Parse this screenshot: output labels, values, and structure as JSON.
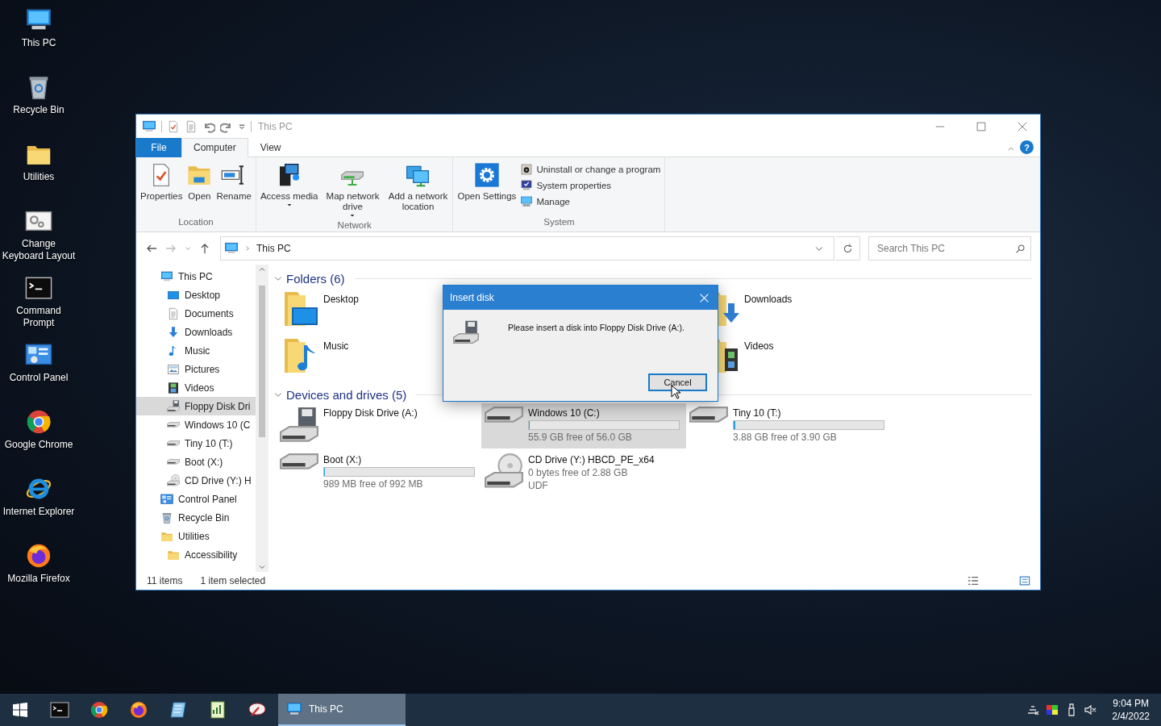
{
  "desktop_icons": [
    {
      "label": "This PC",
      "kind": "pc"
    },
    {
      "label": "Recycle Bin",
      "kind": "bin"
    },
    {
      "label": "Utilities",
      "kind": "folder"
    },
    {
      "label": "Change Keyboard Layout",
      "kind": "settings-window"
    },
    {
      "label": "Command Prompt",
      "kind": "cmd"
    },
    {
      "label": "Control Panel",
      "kind": "cpanel"
    },
    {
      "label": "Google Chrome",
      "kind": "chrome"
    },
    {
      "label": "Internet Explorer",
      "kind": "ie"
    },
    {
      "label": "Mozilla Firefox",
      "kind": "firefox"
    }
  ],
  "window": {
    "title": "This PC"
  },
  "ribbon": {
    "tabs": [
      {
        "label": "File",
        "kind": "file",
        "selected": false
      },
      {
        "label": "Computer",
        "kind": "tab",
        "selected": true
      },
      {
        "label": "View",
        "kind": "tab",
        "selected": false
      }
    ],
    "help": "?",
    "groups": [
      {
        "label": "Location",
        "buttons": [
          {
            "label": "Properties",
            "kind": "properties",
            "dropdown": false
          },
          {
            "label": "Open",
            "kind": "open",
            "dropdown": false
          },
          {
            "label": "Rename",
            "kind": "rename",
            "dropdown": false
          }
        ]
      },
      {
        "label": "Network",
        "buttons": [
          {
            "label": "Access media",
            "kind": "media",
            "dropdown": true
          },
          {
            "label": "Map network drive",
            "kind": "mapdrive",
            "dropdown": true
          },
          {
            "label": "Add a network location",
            "kind": "netloc",
            "dropdown": false
          }
        ]
      },
      {
        "label": "System",
        "buttons": [
          {
            "label": "Open Settings",
            "kind": "gear",
            "dropdown": false
          }
        ],
        "small_buttons": [
          {
            "label": "Uninstall or change a program",
            "kind": "uninstall"
          },
          {
            "label": "System properties",
            "kind": "sysprops"
          },
          {
            "label": "Manage",
            "kind": "manage"
          }
        ]
      }
    ]
  },
  "address_bar": {
    "path": "This PC",
    "search_placeholder": "Search This PC"
  },
  "nav_pane": {
    "items": [
      {
        "label": "This PC",
        "kind": "pc",
        "selected": false,
        "children": [
          {
            "label": "Desktop",
            "kind": "desktop-small",
            "selected": false
          },
          {
            "label": "Documents",
            "kind": "docs",
            "selected": false
          },
          {
            "label": "Downloads",
            "kind": "down",
            "selected": false
          },
          {
            "label": "Music",
            "kind": "music",
            "selected": false
          },
          {
            "label": "Pictures",
            "kind": "pics",
            "selected": false
          },
          {
            "label": "Videos",
            "kind": "videos",
            "selected": false
          },
          {
            "label": "Floppy Disk Dri",
            "kind": "floppy",
            "selected": true
          },
          {
            "label": "Windows 10 (C",
            "kind": "disk",
            "selected": false
          },
          {
            "label": "Tiny 10 (T:)",
            "kind": "disk",
            "selected": false
          },
          {
            "label": "Boot (X:)",
            "kind": "disk",
            "selected": false
          },
          {
            "label": "CD Drive (Y:) H",
            "kind": "cd",
            "selected": false
          }
        ]
      },
      {
        "label": "Control Panel",
        "kind": "cpanel",
        "selected": false
      },
      {
        "label": "Recycle Bin",
        "kind": "bin",
        "selected": false
      },
      {
        "label": "Utilities",
        "kind": "folder",
        "selected": false,
        "children": [
          {
            "label": "Accessibility",
            "kind": "folder",
            "selected": false
          }
        ]
      }
    ]
  },
  "sections": [
    {
      "title": "Folders (6)",
      "expanded": true,
      "kind": "folders",
      "items": [
        {
          "label": "Desktop",
          "kind": "desktopf"
        },
        {
          "label": "Downloads",
          "kind": "downloadsf"
        },
        {
          "label": "Music",
          "kind": "musicf"
        },
        {
          "label": "Videos",
          "kind": "videosf"
        }
      ]
    },
    {
      "title": "Devices and drives (5)",
      "expanded": true,
      "kind": "drives",
      "items": [
        {
          "label": "Floppy Disk Drive (A:)",
          "kind": "floppy",
          "selected": false
        },
        {
          "label": "Windows 10 (C:)",
          "kind": "disk",
          "selected": true,
          "level": 0.002,
          "details": [
            "55.9 GB free of 56.0 GB"
          ]
        },
        {
          "label": "Tiny 10 (T:)",
          "kind": "disk",
          "selected": false,
          "level": 0.012,
          "details": [
            "3.88 GB free of 3.90 GB"
          ]
        },
        {
          "label": "Boot (X:)",
          "kind": "disk",
          "selected": false,
          "level": 0.003,
          "details": [
            "989 MB free of 992 MB"
          ]
        },
        {
          "label": "CD Drive (Y:) HBCD_PE_x64",
          "kind": "cd",
          "selected": false,
          "details": [
            "0 bytes free of 2.88 GB",
            "UDF"
          ]
        }
      ]
    }
  ],
  "status_bar": {
    "count": "11 items",
    "selection": "1 item selected"
  },
  "dialog": {
    "title": "Insert disk",
    "message": "Please insert a disk into Floppy Disk Drive (A:).",
    "button": "Cancel"
  },
  "taskbar": {
    "apps": [
      {
        "kind": "cmd"
      },
      {
        "kind": "chrome"
      },
      {
        "kind": "firefox"
      },
      {
        "kind": "notebook"
      },
      {
        "kind": "chartdoc"
      },
      {
        "kind": "brush"
      }
    ],
    "task": {
      "label": "This PC",
      "selected": true
    },
    "time": "9:04 PM",
    "date": "2/4/2022"
  }
}
